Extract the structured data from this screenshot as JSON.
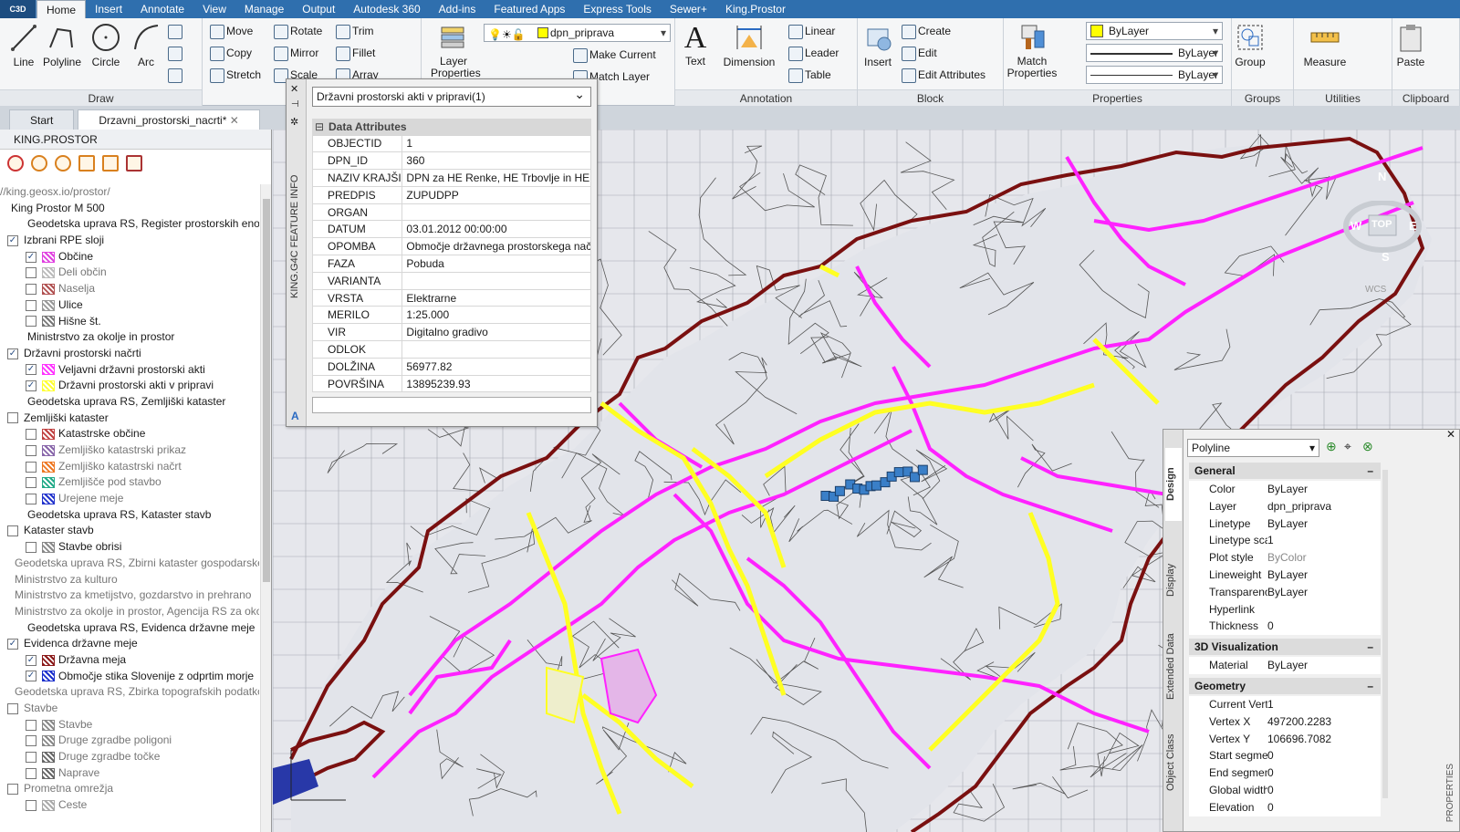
{
  "app": {
    "badge": "C3D"
  },
  "menu": [
    "Home",
    "Insert",
    "Annotate",
    "View",
    "Manage",
    "Output",
    "Autodesk 360",
    "Add-ins",
    "Featured Apps",
    "Express Tools",
    "Sewer+",
    "King.Prostor"
  ],
  "ribbon": {
    "draw": {
      "title": "Draw",
      "line": "Line",
      "polyline": "Polyline",
      "circle": "Circle",
      "arc": "Arc"
    },
    "modify": {
      "move": "Move",
      "rotate": "Rotate",
      "trim": "Trim",
      "copy": "Copy",
      "mirror": "Mirror",
      "fillet": "Fillet",
      "stretch": "Stretch",
      "scale": "Scale",
      "array": "Array"
    },
    "layers": {
      "layer_properties": "Layer Properties",
      "current_layer": "dpn_priprava",
      "make_current": "Make Current",
      "match_layer": "Match Layer"
    },
    "annotation": {
      "title": "Annotation",
      "text": "Text",
      "dimension": "Dimension",
      "linear": "Linear",
      "leader": "Leader",
      "table": "Table"
    },
    "block": {
      "title": "Block",
      "insert": "Insert",
      "create": "Create",
      "edit": "Edit",
      "edit_attributes": "Edit Attributes"
    },
    "properties": {
      "title": "Properties",
      "match_properties": "Match Properties",
      "color": "ByLayer",
      "lineweight": "ByLayer",
      "linetype": "ByLayer"
    },
    "groups": {
      "title": "Groups",
      "group": "Group"
    },
    "utilities": {
      "title": "Utilities",
      "measure": "Measure"
    },
    "clipboard": {
      "title": "Clipboard",
      "paste": "Paste"
    }
  },
  "file_tabs": [
    "Start",
    "Drzavni_prostorski_nacrti*"
  ],
  "left_panel": {
    "title": "KING.PROSTOR",
    "tree": [
      {
        "indent": 0,
        "cb": "none",
        "text": "//king.geosx.io/prostor/",
        "gray": true
      },
      {
        "indent": 12,
        "cb": "none",
        "text": "King Prostor M 500"
      },
      {
        "indent": 30,
        "cb": "none",
        "text": "Geodetska uprava RS, Register prostorskih enot"
      },
      {
        "indent": 8,
        "cb": "checked",
        "text": "Izbrani RPE sloji"
      },
      {
        "indent": 28,
        "cb": "checked",
        "text": "Občine",
        "swatch": "#e040e0"
      },
      {
        "indent": 28,
        "cb": "empty",
        "text": "Deli občin",
        "swatch": "#bbbbbb",
        "gray": true
      },
      {
        "indent": 28,
        "cb": "empty",
        "text": "Naselja",
        "swatch": "#b05050",
        "gray": true
      },
      {
        "indent": 28,
        "cb": "empty",
        "text": "Ulice",
        "swatch": "#999999"
      },
      {
        "indent": 28,
        "cb": "empty",
        "text": "Hišne št.",
        "swatch": "#777777"
      },
      {
        "indent": 30,
        "cb": "none",
        "text": "Ministrstvo za okolje in prostor"
      },
      {
        "indent": 8,
        "cb": "checked",
        "text": "Državni prostorski načrti"
      },
      {
        "indent": 28,
        "cb": "checked",
        "text": "Veljavni državni prostorski akti",
        "swatch": "#ff33ff"
      },
      {
        "indent": 28,
        "cb": "checked",
        "text": "Državni prostorski akti v pripravi",
        "swatch": "#ffff33"
      },
      {
        "indent": 30,
        "cb": "none",
        "text": "Geodetska uprava RS, Zemljiški kataster"
      },
      {
        "indent": 8,
        "cb": "empty",
        "text": "Zemljiški kataster"
      },
      {
        "indent": 28,
        "cb": "empty",
        "text": "Katastrske občine",
        "swatch": "#c04040"
      },
      {
        "indent": 28,
        "cb": "empty",
        "text": "Zemljiško katastrski prikaz",
        "swatch": "#8866aa",
        "gray": true
      },
      {
        "indent": 28,
        "cb": "empty",
        "text": "Zemljiško katastrski načrt",
        "swatch": "#ee7722",
        "gray": true
      },
      {
        "indent": 28,
        "cb": "empty",
        "text": "Zemljišče pod stavbo",
        "swatch": "#22aa88",
        "gray": true
      },
      {
        "indent": 28,
        "cb": "empty",
        "text": "Urejene meje",
        "swatch": "#2233cc",
        "gray": true
      },
      {
        "indent": 30,
        "cb": "none",
        "text": "Geodetska uprava RS, Kataster stavb"
      },
      {
        "indent": 8,
        "cb": "empty",
        "text": "Kataster stavb"
      },
      {
        "indent": 28,
        "cb": "empty",
        "text": "Stavbe obrisi",
        "swatch": "#888888"
      },
      {
        "indent": 16,
        "cb": "none",
        "text": "Geodetska uprava RS, Zbirni kataster gospodarske j",
        "gray": true
      },
      {
        "indent": 16,
        "cb": "none",
        "text": "Ministrstvo za kulturo",
        "gray": true
      },
      {
        "indent": 16,
        "cb": "none",
        "text": "Ministrstvo za kmetijstvo, gozdarstvo in prehrano",
        "gray": true
      },
      {
        "indent": 16,
        "cb": "none",
        "text": "Ministrstvo za okolje in prostor, Agencija RS za okol",
        "gray": true
      },
      {
        "indent": 30,
        "cb": "none",
        "text": "Geodetska uprava RS, Evidenca državne meje"
      },
      {
        "indent": 8,
        "cb": "checked",
        "text": "Evidenca državne meje"
      },
      {
        "indent": 28,
        "cb": "checked",
        "text": "Državna meja",
        "swatch": "#8b1a1a"
      },
      {
        "indent": 28,
        "cb": "checked",
        "text": "Območje stika Slovenije z odprtim morje",
        "swatch": "#1a2fcc"
      },
      {
        "indent": 16,
        "cb": "none",
        "text": "Geodetska uprava RS, Zbirka topografskih podatkov",
        "gray": true
      },
      {
        "indent": 8,
        "cb": "empty",
        "text": "Stavbe",
        "gray": true
      },
      {
        "indent": 28,
        "cb": "empty",
        "text": "Stavbe",
        "swatch": "#888888",
        "gray": true
      },
      {
        "indent": 28,
        "cb": "empty",
        "text": "Druge zgradbe poligoni",
        "swatch": "#888888",
        "gray": true
      },
      {
        "indent": 28,
        "cb": "empty",
        "text": "Druge zgradbe točke",
        "swatch": "#666666",
        "gray": true
      },
      {
        "indent": 28,
        "cb": "empty",
        "text": "Naprave",
        "swatch": "#666666",
        "gray": true
      },
      {
        "indent": 8,
        "cb": "empty",
        "text": "Prometna omrežja",
        "gray": true
      },
      {
        "indent": 28,
        "cb": "empty",
        "text": "Ceste",
        "swatch": "#aaaaaa",
        "gray": true
      }
    ]
  },
  "feature_info": {
    "vertical_title": "KING.G4C FEATURE INFO",
    "selected": "Državni prostorski akti v pripravi(1)",
    "section": "Data Attributes",
    "rows": [
      {
        "k": "OBJECTID",
        "v": "1"
      },
      {
        "k": "DPN_ID",
        "v": "360"
      },
      {
        "k": "NAZIV KRAJŠI",
        "v": "DPN za HE Renke, HE Trbovlje in HE Suh"
      },
      {
        "k": "PREDPIS",
        "v": "ZUPUDPP"
      },
      {
        "k": "ORGAN",
        "v": ""
      },
      {
        "k": "DATUM",
        "v": "03.01.2012 00:00:00"
      },
      {
        "k": "OPOMBA",
        "v": "Območje državnega prostorskega načrt"
      },
      {
        "k": "FAZA",
        "v": "Pobuda"
      },
      {
        "k": "VARIANTA",
        "v": ""
      },
      {
        "k": "VRSTA",
        "v": "Elektrarne"
      },
      {
        "k": "MERILO",
        "v": "1:25.000"
      },
      {
        "k": "VIR",
        "v": "Digitalno gradivo"
      },
      {
        "k": "ODLOK",
        "v": ""
      },
      {
        "k": "DOLŽINA",
        "v": "56977.82"
      },
      {
        "k": "POVRŠINA",
        "v": "13895239.93"
      }
    ]
  },
  "properties_panel": {
    "object_type": "Polyline",
    "tabs": [
      "Design",
      "Display",
      "Extended Data",
      "Object Class"
    ],
    "side_label": "PROPERTIES",
    "sections": [
      {
        "title": "General",
        "rows": [
          {
            "k": "Color",
            "v": "ByLayer"
          },
          {
            "k": "Layer",
            "v": "dpn_priprava"
          },
          {
            "k": "Linetype",
            "v": "ByLayer"
          },
          {
            "k": "Linetype scale",
            "v": "1"
          },
          {
            "k": "Plot style",
            "v": "ByColor"
          },
          {
            "k": "Lineweight",
            "v": "ByLayer"
          },
          {
            "k": "Transparency",
            "v": "ByLayer"
          },
          {
            "k": "Hyperlink",
            "v": ""
          },
          {
            "k": "Thickness",
            "v": "0"
          }
        ]
      },
      {
        "title": "3D Visualization",
        "rows": [
          {
            "k": "Material",
            "v": "ByLayer"
          }
        ]
      },
      {
        "title": "Geometry",
        "rows": [
          {
            "k": "Current Vertex",
            "v": "1"
          },
          {
            "k": "Vertex X",
            "v": "497200.2283"
          },
          {
            "k": "Vertex Y",
            "v": "106696.7082"
          },
          {
            "k": "Start segmen...",
            "v": "0"
          },
          {
            "k": "End segment...",
            "v": "0"
          },
          {
            "k": "Global width",
            "v": "0"
          },
          {
            "k": "Elevation",
            "v": "0"
          }
        ]
      }
    ]
  },
  "viewcube": {
    "top": "TOP",
    "n": "N",
    "s": "S",
    "w": "W",
    "e": "E",
    "wcs": "WCS"
  },
  "colors": {
    "border": "#7a1010",
    "valid": "#ff22ff",
    "planned": "#ffff22",
    "municipality": "#555555",
    "selection": "#3a7fc8"
  }
}
